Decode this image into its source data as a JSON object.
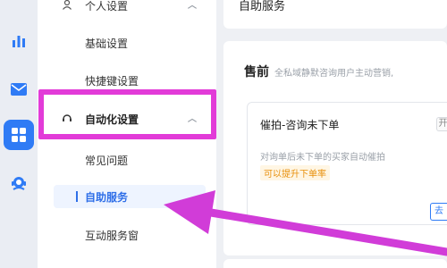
{
  "sidebar": {
    "items": [
      {
        "label": "个人设置",
        "icon": "user-icon"
      },
      {
        "label": "基础设置"
      },
      {
        "label": "快捷键设置"
      },
      {
        "label": "自动化设置",
        "icon": "headset-icon"
      },
      {
        "label": "常见问题"
      },
      {
        "label": "自助服务"
      },
      {
        "label": "互动服务窗"
      }
    ]
  },
  "rail": {
    "icons": [
      "bar-chart-icon",
      "mail-icon",
      "apps-grid-icon",
      "support-agent-icon"
    ]
  },
  "main": {
    "header": "自助服务",
    "section": {
      "title": "售前",
      "description": "全私域静默咨询用户主动营销,"
    },
    "feature": {
      "title": "催拍-咨询未下单",
      "description": "对询单后未下单的买家自动催拍",
      "tag": "可以提升下单率",
      "badge": "开",
      "button": "去"
    }
  },
  "colors": {
    "accent": "#2f7bf5",
    "highlight": "#e23bd8",
    "tag_text": "#e8900c"
  }
}
